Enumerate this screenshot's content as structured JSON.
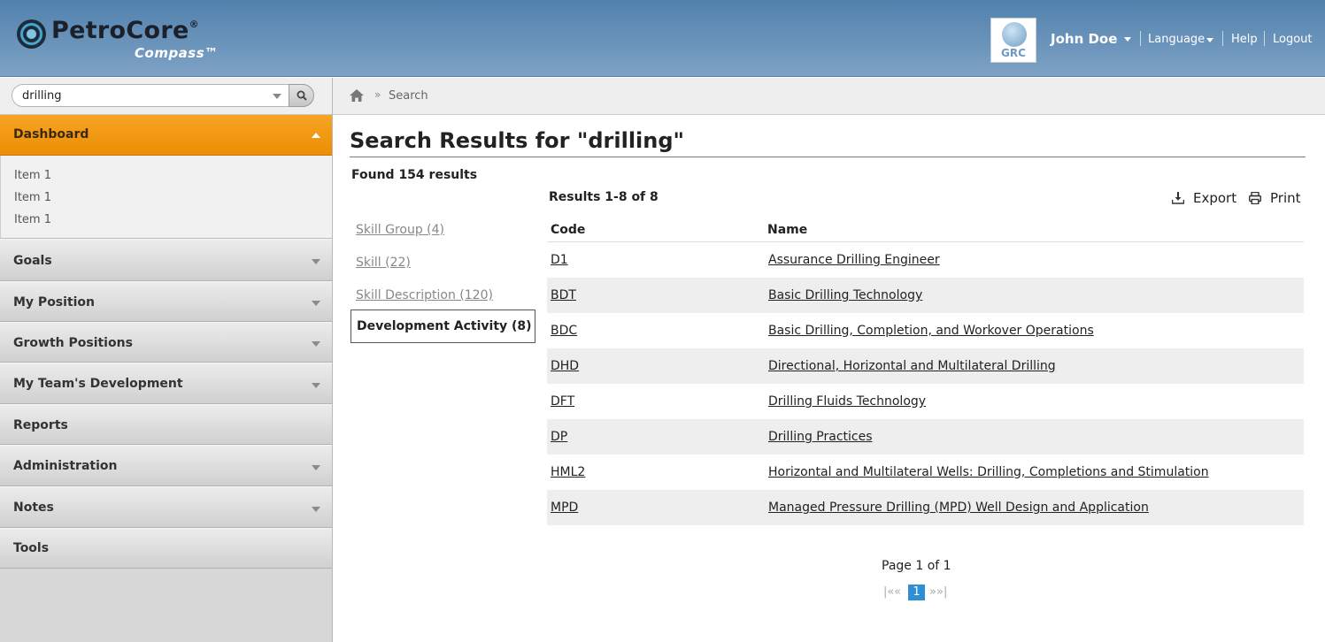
{
  "header": {
    "logo_text": "PetroCore",
    "logo_sub": "Compass™",
    "badge_text": "GRC",
    "user_name": "John Doe",
    "language_label": "Language",
    "help_label": "Help",
    "logout_label": "Logout"
  },
  "search": {
    "value": "drilling",
    "placeholder": ""
  },
  "sidebar": {
    "dashboard": "Dashboard",
    "dashboard_items": [
      "Item 1",
      "Item 1",
      "Item 1"
    ],
    "sections": [
      "Goals",
      "My Position",
      "Growth Positions",
      "My Team's Development",
      "Reports",
      "Administration",
      "Notes",
      "Tools"
    ]
  },
  "breadcrumb": {
    "separator": "»",
    "current": "Search"
  },
  "main": {
    "title": "Search Results for \"drilling\"",
    "found": "Found 154 results",
    "range": "Results 1-8 of 8",
    "export_label": "Export",
    "print_label": "Print",
    "facets": [
      "Skill Group (4)",
      "Skill (22)",
      "Skill Description (120)"
    ],
    "active_facet": "Development Activity (8)",
    "columns": {
      "code": "Code",
      "name": "Name"
    },
    "rows": [
      {
        "code": "D1",
        "name": "Assurance Drilling Engineer"
      },
      {
        "code": "BDT",
        "name": "Basic Drilling Technology"
      },
      {
        "code": "BDC",
        "name": "Basic Drilling, Completion, and Workover Operations"
      },
      {
        "code": "DHD",
        "name": "Directional, Horizontal and Multilateral Drilling"
      },
      {
        "code": "DFT",
        "name": "Drilling Fluids Technology"
      },
      {
        "code": "DP",
        "name": "Drilling Practices"
      },
      {
        "code": "HML2",
        "name": "Horizontal and Multilateral Wells: Drilling, Completions and Stimulation"
      },
      {
        "code": "MPD",
        "name": "Managed Pressure Drilling (MPD) Well Design and Application"
      }
    ],
    "pagination": {
      "info": "Page 1 of 1",
      "first": "|«",
      "prev": "«",
      "current": "1",
      "next": "»",
      "last": "»|"
    }
  },
  "colors": {
    "accent": "#ec8d06",
    "header": "#5181ad",
    "page_current": "#2e8fd4"
  }
}
